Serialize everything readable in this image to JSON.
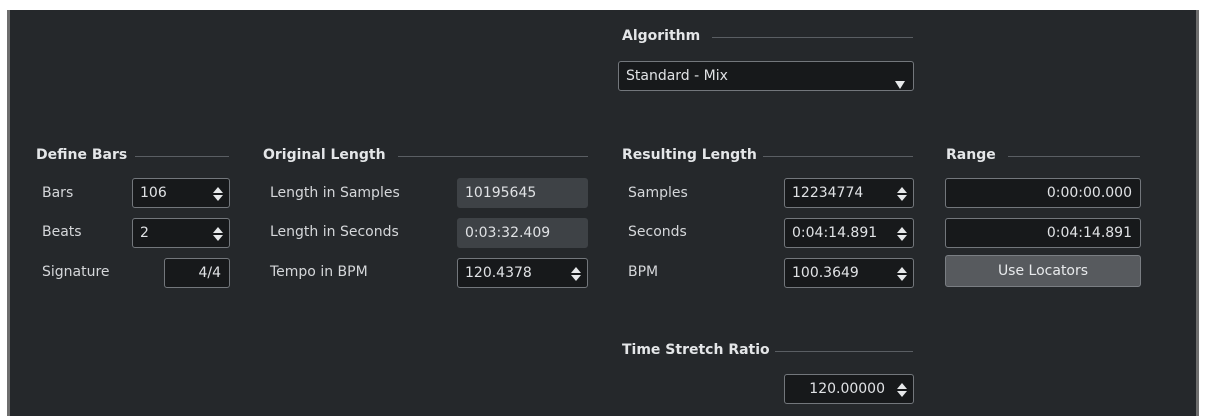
{
  "algorithm": {
    "heading": "Algorithm",
    "selected": "Standard - Mix"
  },
  "define_bars": {
    "heading": "Define Bars",
    "bars_label": "Bars",
    "bars_value": "106",
    "beats_label": "Beats",
    "beats_value": "2",
    "signature_label": "Signature",
    "signature_value": "4/4"
  },
  "original_length": {
    "heading": "Original Length",
    "samples_label": "Length in Samples",
    "samples_value": "10195645",
    "seconds_label": "Length in Seconds",
    "seconds_value": "0:03:32.409",
    "tempo_label": "Tempo in BPM",
    "tempo_value": "120.4378"
  },
  "resulting_length": {
    "heading": "Resulting Length",
    "samples_label": "Samples",
    "samples_value": "12234774",
    "seconds_label": "Seconds",
    "seconds_value": "0:04:14.891",
    "bpm_label": "BPM",
    "bpm_value": "100.3649"
  },
  "range": {
    "heading": "Range",
    "start_value": "0:00:00.000",
    "end_value": "0:04:14.891",
    "use_locators_label": "Use Locators"
  },
  "time_stretch": {
    "heading": "Time Stretch Ratio",
    "value": "120.00000"
  },
  "icons": {
    "spin": "spin-arrows-icon",
    "dropdown": "dropdown-triangle-icon"
  }
}
